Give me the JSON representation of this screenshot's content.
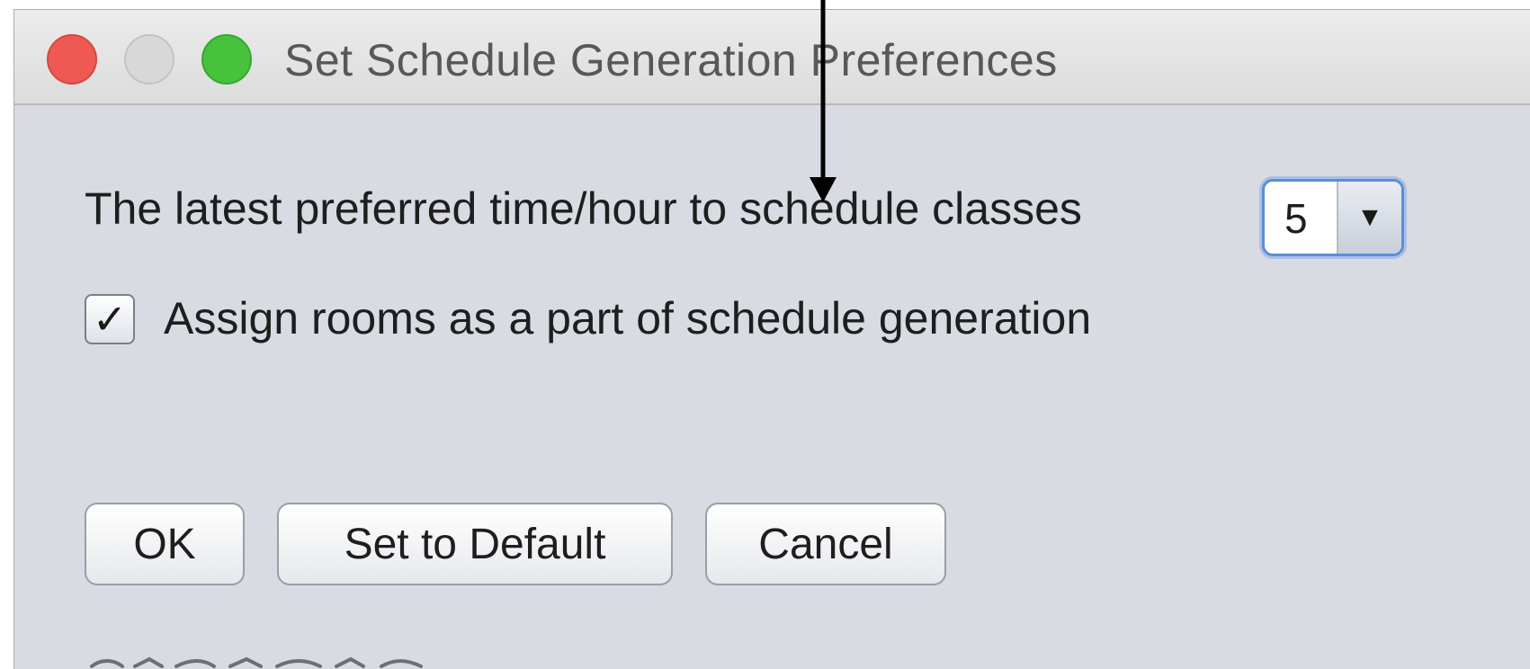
{
  "window": {
    "title": "Set Schedule Generation Preferences",
    "buttons": [
      "close",
      "minimize",
      "zoom"
    ]
  },
  "preferences": {
    "latest_time_label": "The latest preferred time/hour to schedule classes",
    "latest_time_value": "5",
    "dropdown_icon": "triangle-down-icon",
    "assign_rooms_label": "Assign rooms as a part of schedule generation",
    "assign_rooms_checked": true,
    "checkmark": "✓"
  },
  "actions": {
    "ok_label": "OK",
    "set_default_label": "Set to Default",
    "cancel_label": "Cancel"
  },
  "annotation": {
    "icon": "down-arrow-icon",
    "color": "#000000"
  },
  "colors": {
    "close": "#ee5a53",
    "minimize": "#d8d8d8",
    "zoom": "#48c13d",
    "focus_ring": "#5a8fd8",
    "panel_background": "#d9dbe3"
  }
}
